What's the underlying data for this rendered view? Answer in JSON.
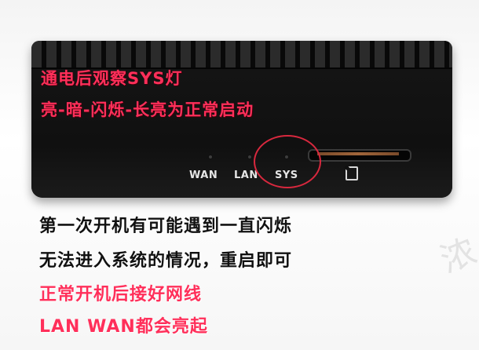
{
  "device": {
    "ports": [
      {
        "label": "WAN"
      },
      {
        "label": "LAN"
      },
      {
        "label": "SYS"
      }
    ],
    "highlighted_port": "SYS",
    "body_color": "#111111",
    "icons": [
      "sd-card-slot-icon"
    ]
  },
  "captions": {
    "line1": "通电后观察SYS灯",
    "line2": "亮-暗-闪烁-长亮为正常启动",
    "line3": "第一次开机有可能遇到一直闪烁",
    "line4": "无法进入系统的情况，重启即可",
    "line5": "正常开机后接好网线",
    "line6": "LAN WAN都会亮起"
  },
  "colors": {
    "highlight_red": "#ff2f5a",
    "circle_red": "#d8283e",
    "text_black": "#111111"
  }
}
